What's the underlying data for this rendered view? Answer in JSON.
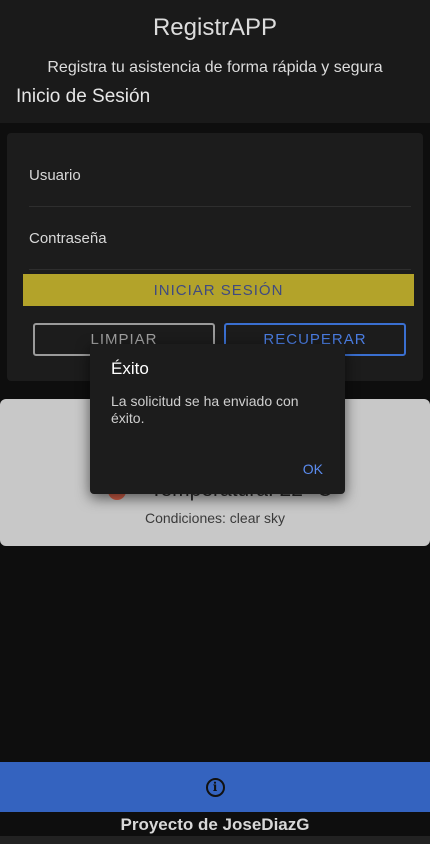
{
  "header": {
    "title": "RegistrAPP",
    "subtitle": "Registra tu asistencia de forma rápida y segura",
    "section": "Inicio de Sesión"
  },
  "login": {
    "user_label": "Usuario",
    "pass_label": "Contraseña",
    "login_button": "INICIAR SESIÓN",
    "clear_button": "LIMPIAR",
    "recover_button": "RECUPERAR"
  },
  "weather": {
    "temperature": "Temperatura: 22 °C",
    "conditions": "Condiciones: clear sky"
  },
  "dialog": {
    "title": "Éxito",
    "message": "La solicitud se ha enviado con éxito.",
    "ok": "OK"
  },
  "footer": {
    "info_icon": "info-icon",
    "credit": "Proyecto de JoseDiazG"
  },
  "colors": {
    "accent_yellow": "#b3a32a",
    "primary_blue": "#3463bf"
  }
}
